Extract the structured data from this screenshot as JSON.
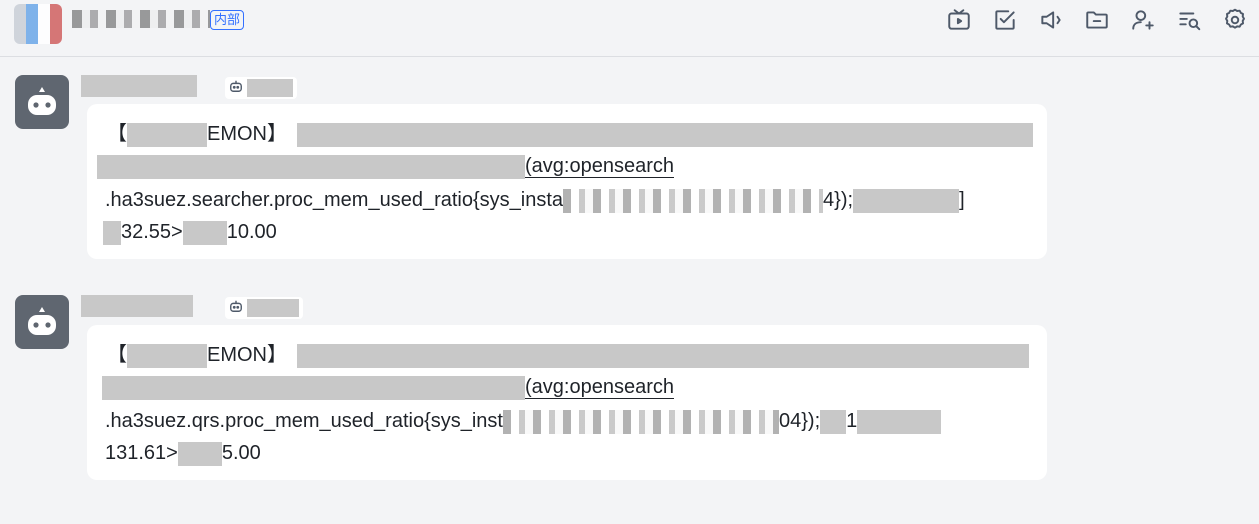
{
  "header": {
    "group_tag": "内部",
    "icons": [
      "tv-icon",
      "checkbox-icon",
      "announcement-icon",
      "folder-icon",
      "add-member-icon",
      "search-history-icon",
      "settings-icon"
    ]
  },
  "messages": [
    {
      "line1_bracket_open": "【",
      "line1_text": "EMON】",
      "line2_text": "(avg:opensearch",
      "line3_text": ".ha3suez.searcher.proc_mem_used_ratio{sys_insta",
      "line3_suffix": "4});",
      "line3_close": "]",
      "line4_value": "32.55>",
      "line4_threshold": "10.00"
    },
    {
      "line1_bracket_open": "【",
      "line1_text": "EMON】",
      "line2_text": "(avg:opensearch",
      "line3_text": ".ha3suez.qrs.proc_mem_used_ratio{sys_inst",
      "line3_suffix": "04});",
      "line3_mid": "1",
      "line4_value": "131.61>",
      "line4_threshold": "5.00"
    }
  ]
}
